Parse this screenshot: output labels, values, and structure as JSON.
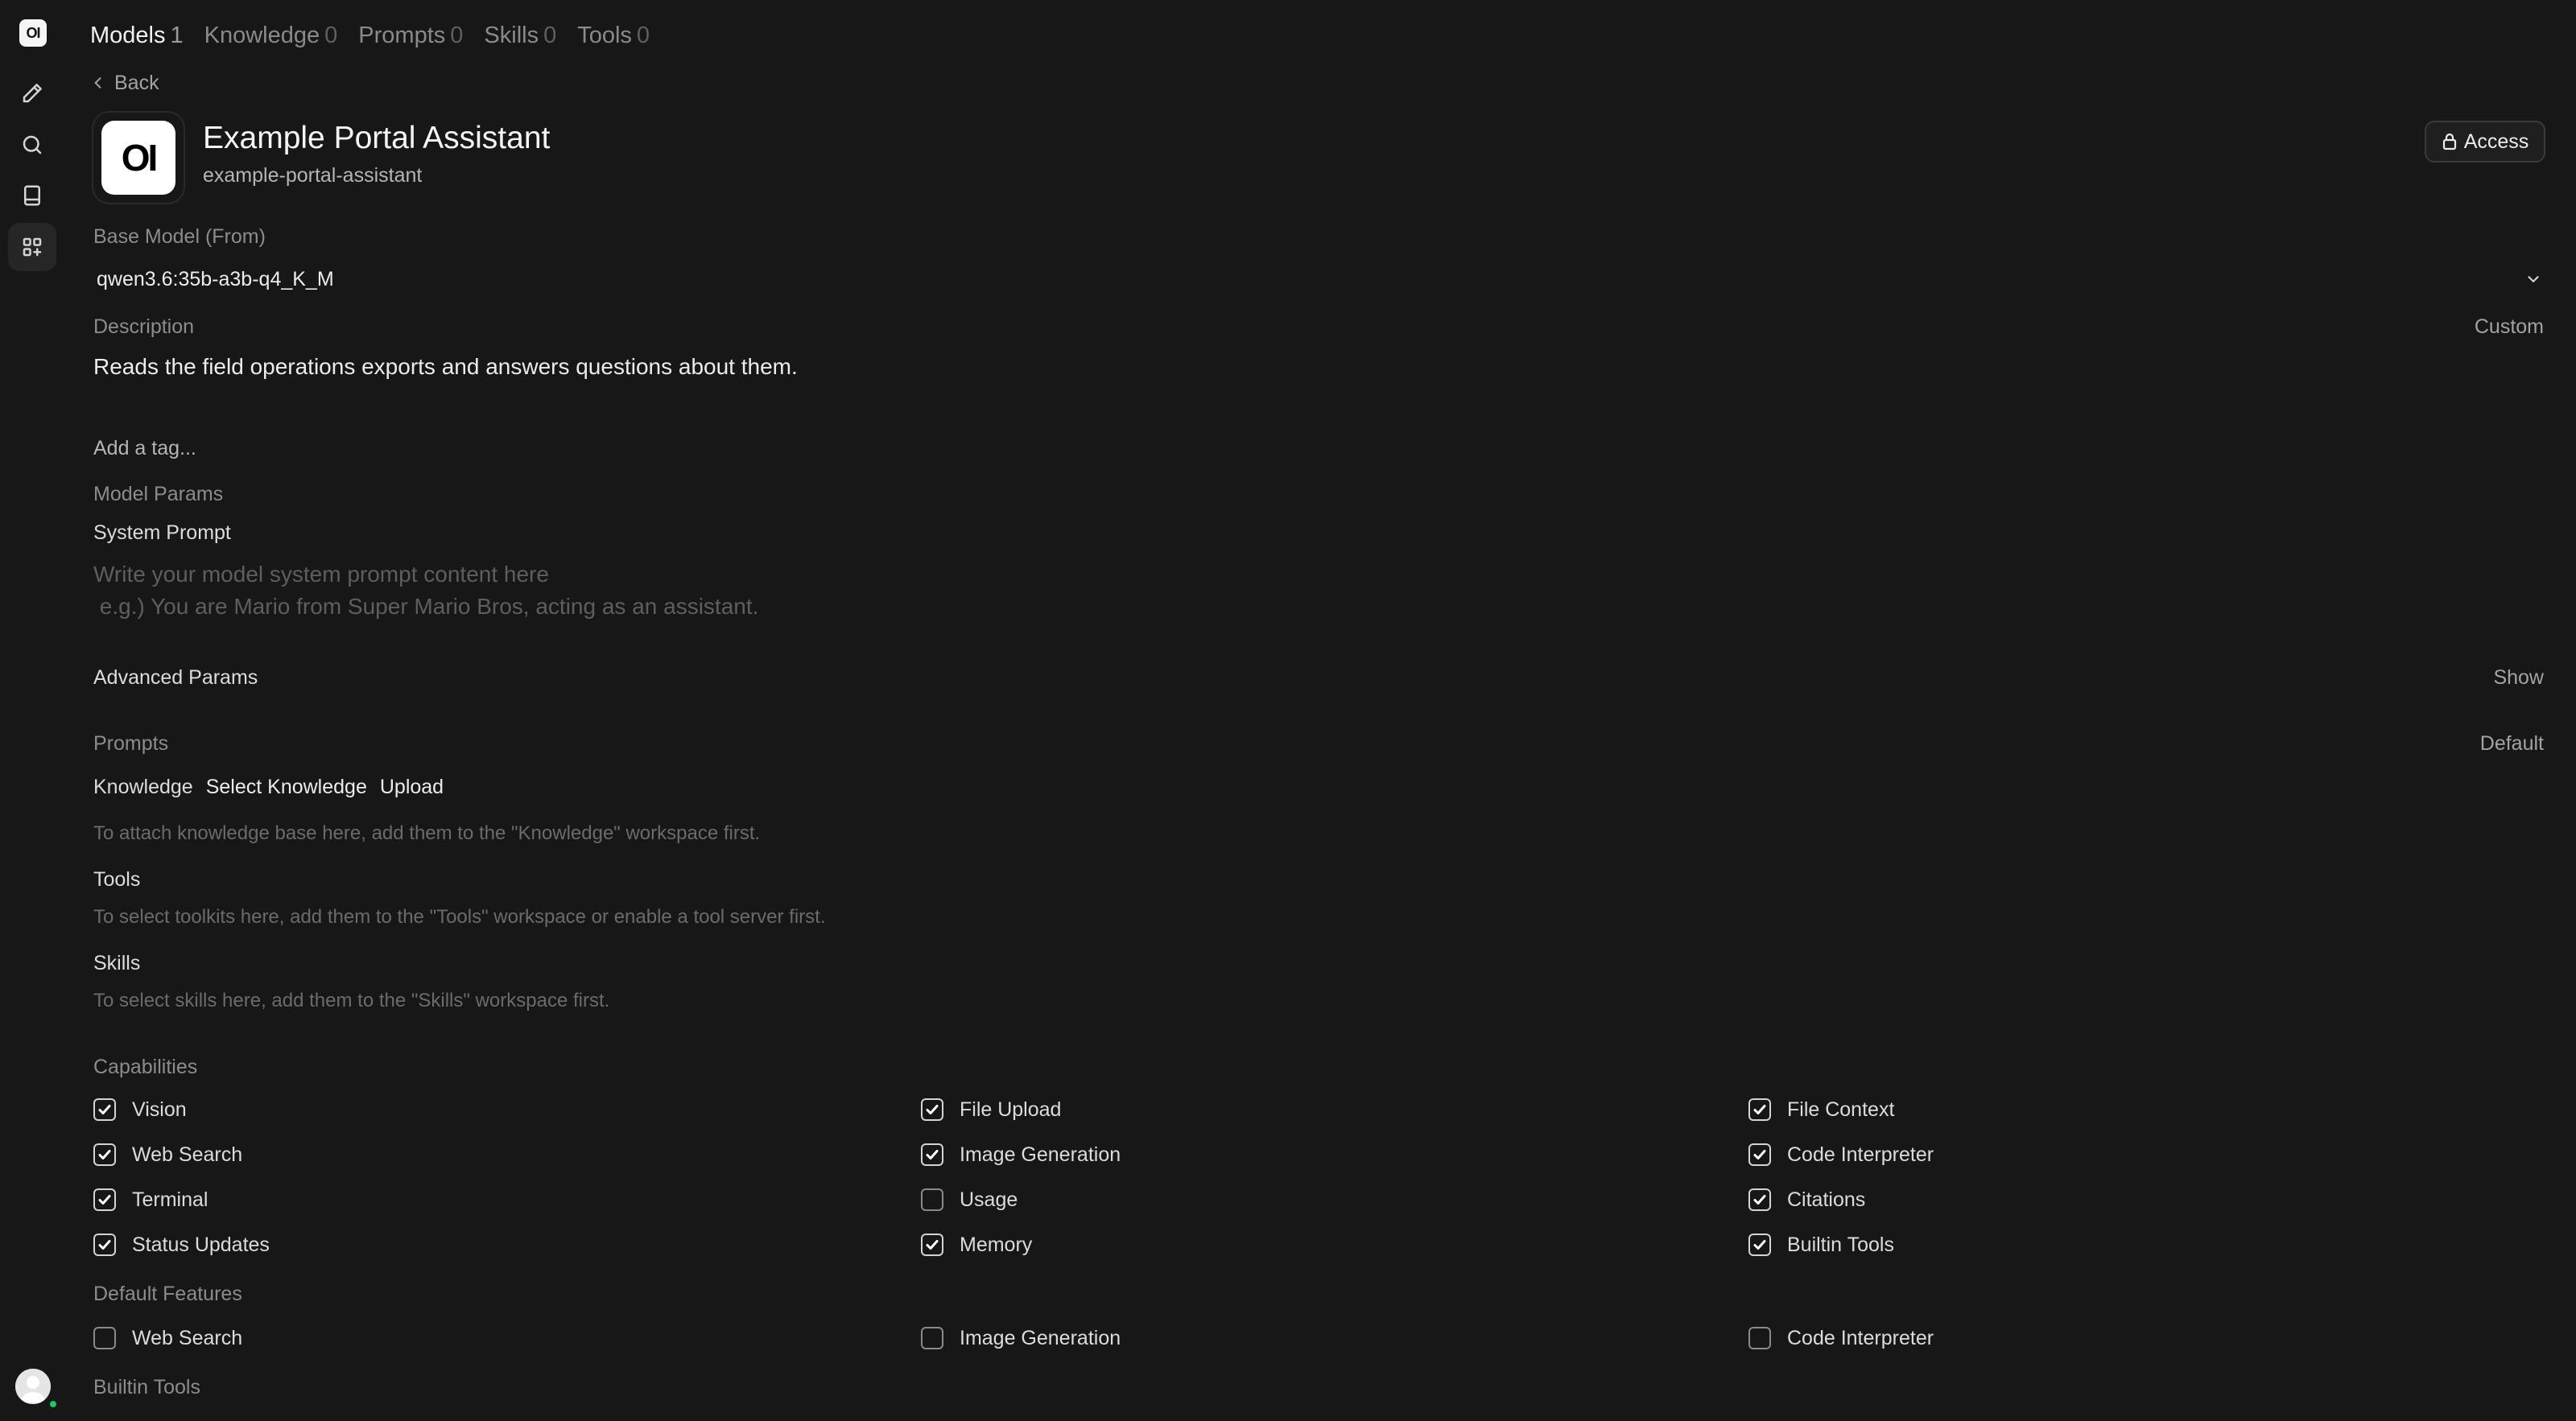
{
  "rail": {
    "logo": "OI",
    "items": [
      {
        "icon": "pencil-icon"
      },
      {
        "icon": "search-icon"
      },
      {
        "icon": "notebook-icon"
      },
      {
        "icon": "workspace-grid-icon",
        "active": true
      }
    ]
  },
  "tabs": [
    {
      "label": "Models",
      "count": "1",
      "active": true
    },
    {
      "label": "Knowledge",
      "count": "0"
    },
    {
      "label": "Prompts",
      "count": "0"
    },
    {
      "label": "Skills",
      "count": "0"
    },
    {
      "label": "Tools",
      "count": "0"
    }
  ],
  "back_label": "Back",
  "model": {
    "avatar_text": "OI",
    "name": "Example Portal Assistant",
    "id": "example-portal-assistant",
    "access_label": "Access"
  },
  "base_model": {
    "label": "Base Model (From)",
    "value": "qwen3.6:35b-a3b-q4_K_M"
  },
  "description": {
    "label": "Description",
    "mode": "Custom",
    "text": "Reads the field operations exports and answers questions about them."
  },
  "tag_placeholder": "Add a tag...",
  "model_params_label": "Model Params",
  "system_prompt": {
    "label": "System Prompt",
    "placeholder": "Write your model system prompt content here\n e.g.) You are Mario from Super Mario Bros, acting as an assistant."
  },
  "advanced_params": {
    "label": "Advanced Params",
    "toggle": "Show"
  },
  "prompts": {
    "label": "Prompts",
    "value": "Default"
  },
  "knowledge": {
    "label": "Knowledge",
    "select_label": "Select Knowledge",
    "upload_label": "Upload",
    "hint": "To attach knowledge base here, add them to the \"Knowledge\" workspace first."
  },
  "tools": {
    "label": "Tools",
    "hint": "To select toolkits here, add them to the \"Tools\" workspace or enable a tool server first."
  },
  "skills": {
    "label": "Skills",
    "hint": "To select skills here, add them to the \"Skills\" workspace first."
  },
  "capabilities": {
    "label": "Capabilities",
    "items": [
      {
        "label": "Vision",
        "checked": true
      },
      {
        "label": "File Upload",
        "checked": true
      },
      {
        "label": "File Context",
        "checked": true
      },
      {
        "label": "Web Search",
        "checked": true
      },
      {
        "label": "Image Generation",
        "checked": true
      },
      {
        "label": "Code Interpreter",
        "checked": true
      },
      {
        "label": "Terminal",
        "checked": true
      },
      {
        "label": "Usage",
        "checked": false
      },
      {
        "label": "Citations",
        "checked": true
      },
      {
        "label": "Status Updates",
        "checked": true
      },
      {
        "label": "Memory",
        "checked": true
      },
      {
        "label": "Builtin Tools",
        "checked": true
      }
    ]
  },
  "default_features": {
    "label": "Default Features",
    "items": [
      {
        "label": "Web Search",
        "checked": false
      },
      {
        "label": "Image Generation",
        "checked": false
      },
      {
        "label": "Code Interpreter",
        "checked": false
      }
    ]
  },
  "builtin_tools_label": "Builtin Tools"
}
